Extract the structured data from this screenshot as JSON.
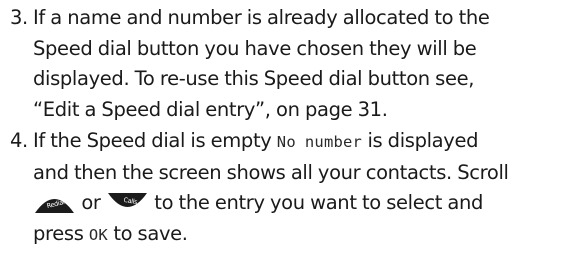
{
  "steps": [
    {
      "number": "3.",
      "lines": [
        "If a name and number is already allocated to the",
        "Speed dial button you have chosen they will be",
        "displayed. To re-use this Speed dial button see,",
        "“Edit a Speed dial entry”, on page 31."
      ]
    },
    {
      "number": "4.",
      "line1_pre": "If the Speed dial is empty ",
      "line1_display": "No number",
      "line1_post": " is displayed",
      "line2": "and then the screen shows all your contacts. Scroll",
      "line3_mid": " or ",
      "line3_post": " to the entry you want to select and",
      "line4_pre": "press ",
      "line4_display": "OK",
      "line4_post": " to save.",
      "redial_key_label": "Redial",
      "calls_key_label": "Calls"
    }
  ],
  "icons": {
    "redial_key": "redial-key-icon",
    "calls_key": "calls-key-icon",
    "key_color": "#1b1b1b"
  }
}
